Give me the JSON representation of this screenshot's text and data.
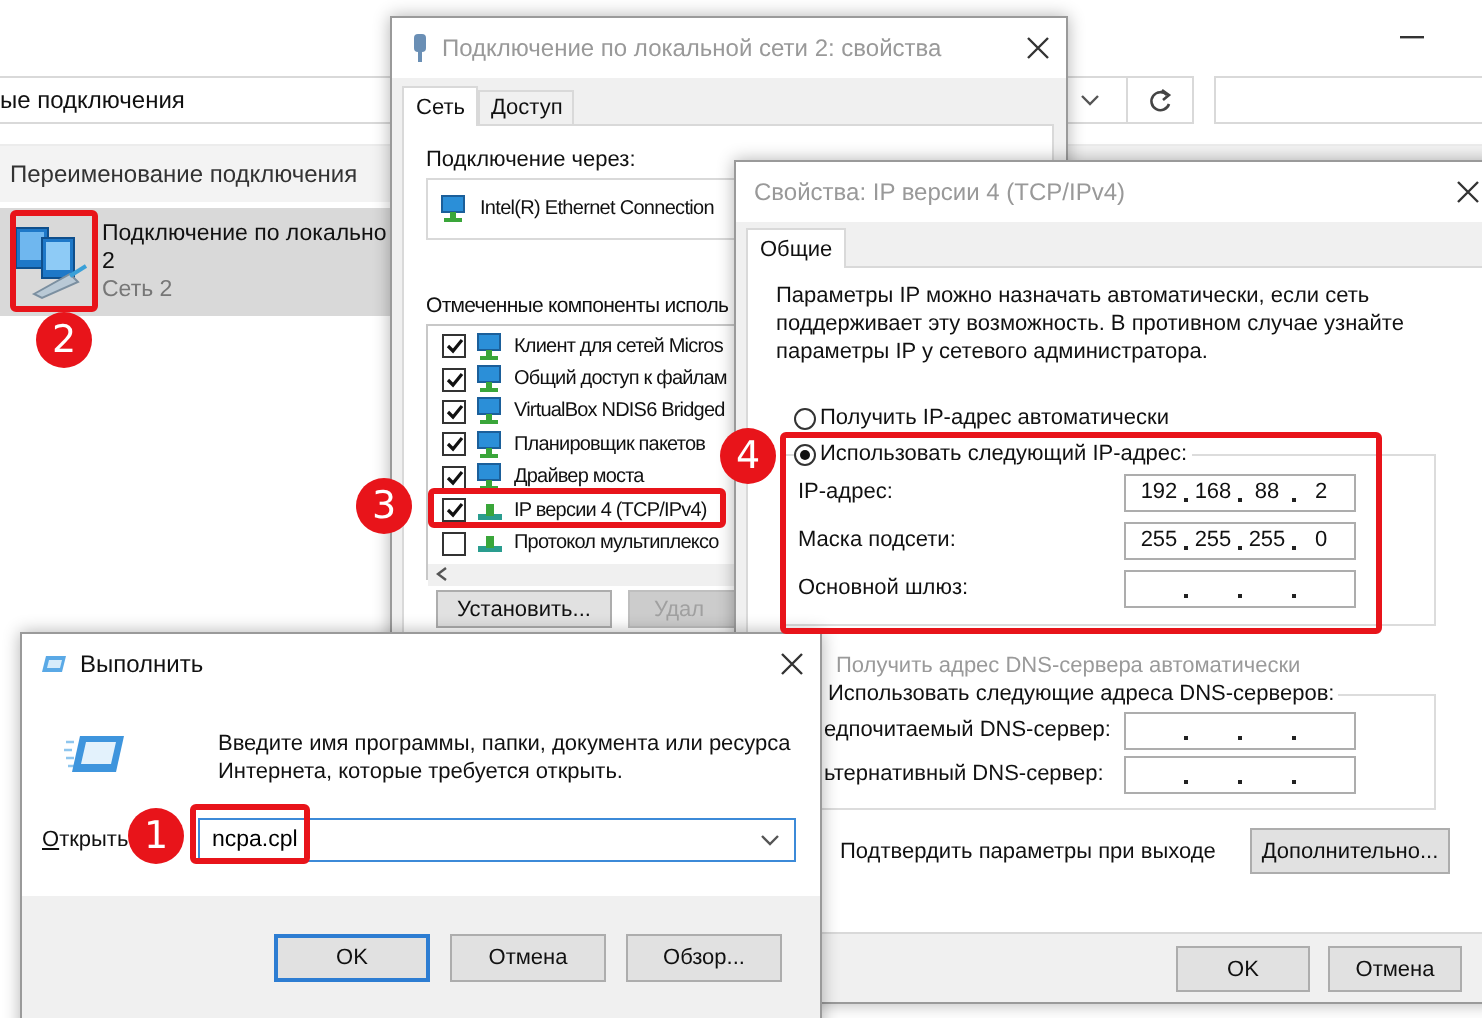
{
  "explorer": {
    "address": "ые подключения",
    "command": "Переименование подключения",
    "connection": {
      "name": "Подключение по локально",
      "name_cont": "2",
      "network": "Сеть 2",
      "selected": true
    }
  },
  "properties_dialog": {
    "title": "Подключение по локальной сети 2: свойства",
    "tabs": [
      {
        "label": "Сеть",
        "selected": true
      },
      {
        "label": "Доступ",
        "selected": false
      }
    ],
    "connect_via_label": "Подключение через:",
    "adapter": "Intel(R) Ethernet Connection",
    "components_label": "Отмеченные компоненты исполь",
    "components": [
      {
        "name": "Клиент для сетей Micros",
        "checked": true,
        "kind": "service"
      },
      {
        "name": "Общий доступ к файлам",
        "checked": true,
        "kind": "service"
      },
      {
        "name": "VirtualBox NDIS6 Bridged",
        "checked": true,
        "kind": "service"
      },
      {
        "name": "Планировщик пакетов",
        "checked": true,
        "kind": "service"
      },
      {
        "name": "Драйвер моста",
        "checked": true,
        "kind": "service"
      },
      {
        "name": "IP версии 4 (TCP/IPv4)",
        "checked": true,
        "kind": "protocol"
      },
      {
        "name": "Протокол мультиплексо",
        "checked": false,
        "kind": "protocol"
      }
    ],
    "buttons": [
      {
        "label": "Установить...",
        "disabled": false
      },
      {
        "label": "Удал",
        "disabled": true
      }
    ]
  },
  "ipv4_dialog": {
    "title": "Свойства: IP версии 4 (TCP/IPv4)",
    "tabs": [
      {
        "label": "Общие",
        "selected": true
      }
    ],
    "description": "Параметры IP можно назначать автоматически, если сеть поддерживает эту возможность. В противном случае узнайте параметры IP у сетевого администратора.",
    "ip_options": [
      {
        "label": "Получить IP-адрес автоматически",
        "selected": false
      },
      {
        "label": "Использовать следующий IP-адрес:",
        "selected": true
      }
    ],
    "ip_fields": [
      {
        "label": "IP-адрес:",
        "octets": [
          "192",
          "168",
          "88",
          "2"
        ]
      },
      {
        "label": "Маска подсети:",
        "octets": [
          "255",
          "255",
          "255",
          "0"
        ]
      },
      {
        "label": "Основной шлюз:"
      }
    ],
    "dns_options": [
      {
        "label": "Получить адрес DNS-сервера автоматически",
        "disabled": true
      },
      {
        "label": "Использовать следующие адреса DNS-серверов:",
        "disabled": false
      }
    ],
    "dns_fields": [
      {
        "label": "едпочитаемый DNS-сервер:"
      },
      {
        "label": "ьтернативный DNS-сервер:"
      }
    ],
    "validate_label": "Подтвердить параметры при выходе",
    "advanced_button": "Дополнительно...",
    "buttons": [
      "OK",
      "Отмена"
    ]
  },
  "run_dialog": {
    "title": "Выполнить",
    "description": "Введите имя программы, папки, документа или ресурса Интернета, которые требуется открыть.",
    "open_label": "Открыть",
    "command": "ncpa.cpl",
    "buttons": [
      {
        "label": "OK",
        "default": true
      },
      {
        "label": "Отмена",
        "default": false
      },
      {
        "label": "Обзор...",
        "default": false
      }
    ]
  },
  "callouts": [
    {
      "number": "1"
    },
    {
      "number": "2"
    },
    {
      "number": "3"
    },
    {
      "number": "4"
    }
  ]
}
